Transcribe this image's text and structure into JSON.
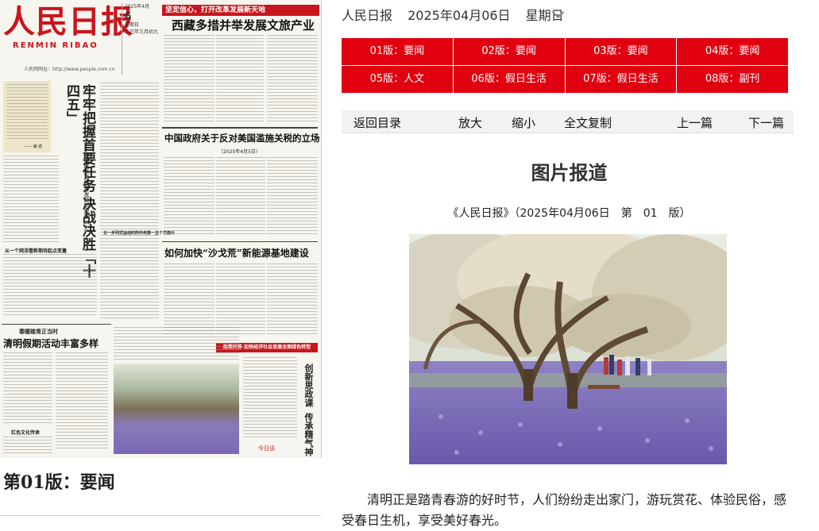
{
  "newspaper": {
    "masthead_cn": "人民日报",
    "masthead_en": "RENMIN RIBAO",
    "masthead_url": "人民网网址：http://www.people.com.cn",
    "date_line": "2025年4月",
    "day": "6",
    "weekday": "星期日",
    "lunar": "乙巳年三月初九",
    "tag_banner": "坚定信心，打开改革发展新天地",
    "headline_top": "西藏多措并举发展文旅产业",
    "quote_author": "—— 编 者",
    "lead_vertical": "牢牢把握首要任务 决战决胜「十四五」",
    "lead_sub_vertical": "——中国经济高质量发展新观察（上）",
    "section_head": "从一个网活看新期待起点变量",
    "headline_policy": "中国政府关于反对美国滥施关税的立场",
    "policy_date": "（2025年4月5日）",
    "headline_shagehuang": "如何加快“沙戈荒”新能源基地建设",
    "kicker_qingming": "春暖踏青正当时",
    "headline_qingming": "清明假期活动丰富多样",
    "subhead_red": "红色文化传承",
    "subhead_small": "云一步列式运动时的中央第一五个方面计",
    "redbar": "政策同答·加快经济社会发展全面绿色转型",
    "vertical_side_1": "创新思政课",
    "vertical_side_2": "传承精气神",
    "stamp": "今日谈",
    "page_caption": "第01版：要闻"
  },
  "header": {
    "paper_name": "人民日报",
    "date": "2025年04月06日",
    "weekday": "星期日"
  },
  "editions": [
    {
      "label": "01版：要闻"
    },
    {
      "label": "02版：要闻"
    },
    {
      "label": "03版：要闻"
    },
    {
      "label": "04版：要闻"
    },
    {
      "label": "05版：人文"
    },
    {
      "label": "06版：假日生活"
    },
    {
      "label": "07版：假日生活"
    },
    {
      "label": "08版：副刊"
    }
  ],
  "toolbar": {
    "back": "返回目录",
    "zoom_in": "放大",
    "zoom_out": "缩小",
    "copy_all": "全文复制",
    "prev": "上一篇",
    "next": "下一篇"
  },
  "article": {
    "title": "图片报道",
    "source": "《人民日报》（2025年04月06日　第　01　版）",
    "paragraph": "清明正是踏青春游的好时节，人们纷纷走出家门，游玩赏花、体验民俗，感受春日生机，享受美好春光。"
  },
  "colors": {
    "brand_red": "#c8161d",
    "edition_red": "#e00010",
    "flower_purple": "#7c68b6"
  }
}
